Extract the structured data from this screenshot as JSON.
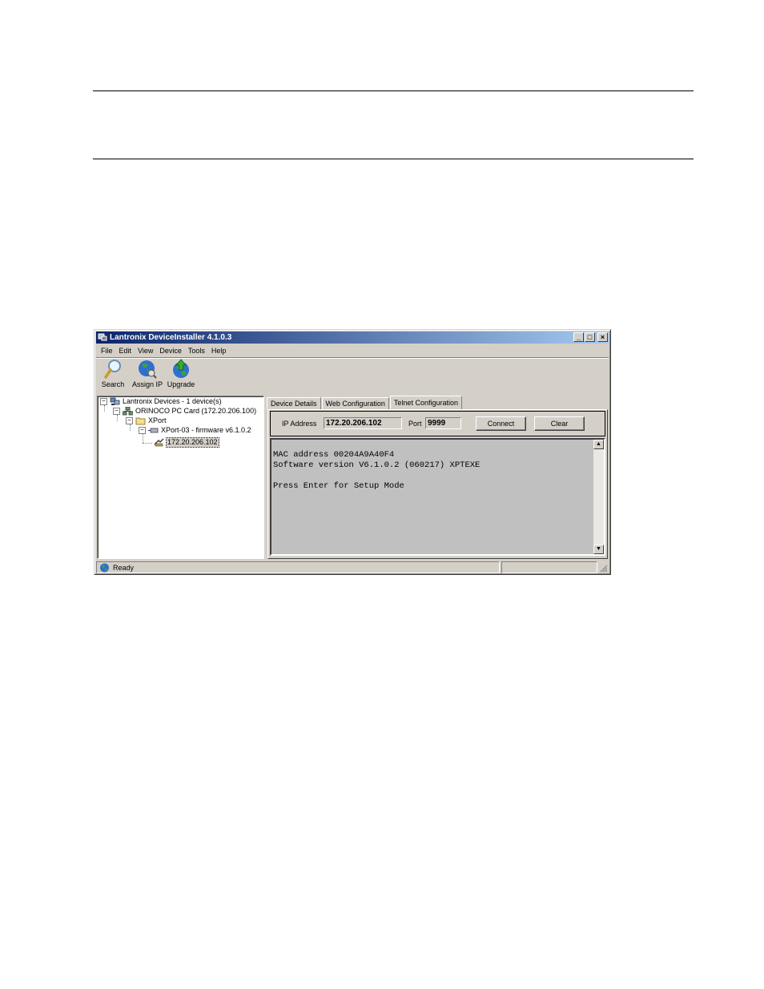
{
  "window": {
    "title": "Lantronix DeviceInstaller 4.1.0.3",
    "controls": [
      "_",
      "□",
      "×"
    ]
  },
  "menu": [
    "File",
    "Edit",
    "View",
    "Device",
    "Tools",
    "Help"
  ],
  "toolbar": {
    "search": "Search",
    "assign_ip": "Assign IP",
    "upgrade": "Upgrade"
  },
  "tree": {
    "root": "Lantronix Devices - 1 device(s)",
    "adapter": "ORINOCO PC Card (172.20.206.100)",
    "folder": "XPort",
    "device_type": "XPort-03 - firmware v6.1.0.2",
    "device": "172.20.206.102"
  },
  "tabs": [
    "Device Details",
    "Web Configuration",
    "Telnet Configuration"
  ],
  "telnet": {
    "ip_label": "IP Address",
    "ip_value": "172.20.206.102",
    "port_label": "Port",
    "port_value": "9999",
    "connect": "Connect",
    "clear": "Clear",
    "output": "MAC address 00204A9A40F4\nSoftware version V6.1.0.2 (060217) XPTEXE\n\nPress Enter for Setup Mode"
  },
  "status": {
    "text": "Ready"
  }
}
